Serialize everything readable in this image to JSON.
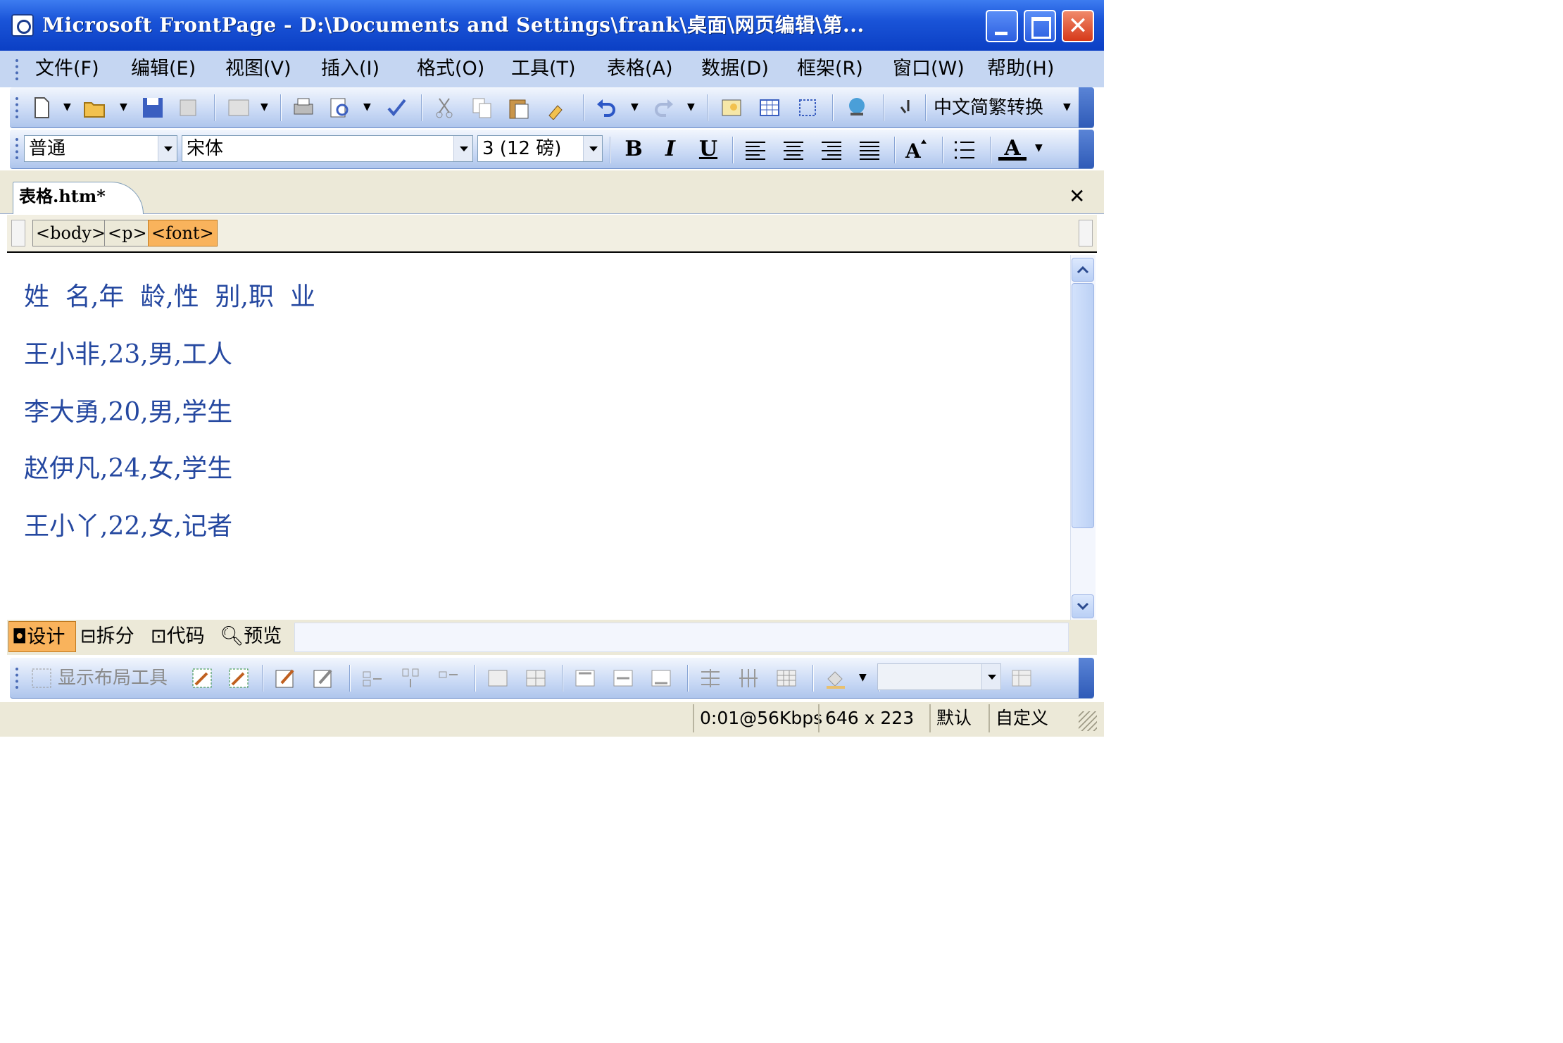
{
  "window": {
    "title": "Microsoft FrontPage - D:\\Documents and Settings\\frank\\桌面\\网页编辑\\第...",
    "close_symbol": "✕"
  },
  "menu": {
    "items": [
      {
        "label": "文件(F)"
      },
      {
        "label": "编辑(E)"
      },
      {
        "label": "视图(V)"
      },
      {
        "label": "插入(I)"
      },
      {
        "label": "格式(O)"
      },
      {
        "label": "工具(T)"
      },
      {
        "label": "表格(A)"
      },
      {
        "label": "数据(D)"
      },
      {
        "label": "框架(R)"
      },
      {
        "label": "窗口(W)"
      },
      {
        "label": "帮助(H)"
      }
    ]
  },
  "toolbar_standard": {
    "icons": [
      "new-page-icon",
      "open-icon",
      "save-icon",
      "publish-icon",
      "web-component-icon",
      "print-icon",
      "print-preview-icon",
      "spelling-icon",
      "cut-icon",
      "copy-icon",
      "paste-icon",
      "format-painter-icon",
      "undo-icon",
      "redo-icon",
      "insert-picture-icon",
      "insert-table-icon",
      "insert-layer-icon",
      "hyperlink-icon",
      "show-all-icon"
    ],
    "chinese_conversion_label": "中文简繁转换"
  },
  "toolbar_formatting": {
    "style_value": "普通",
    "font_value": "宋体",
    "size_value": "3 (12 磅)",
    "bold": "B",
    "italic": "I",
    "underline": "U",
    "font_color_glyph": "A",
    "font_color": "#000000"
  },
  "document": {
    "tab_label": "表格.htm*",
    "close_symbol": "✕",
    "tags": [
      "<body>",
      "<p>",
      "<font>"
    ],
    "selected_tag": "<font>",
    "text_color": "#2548a0",
    "lines": [
      "姓  名,年  龄,性  别,职  业",
      "王小非,23,男,工人",
      "李大勇,20,男,学生",
      "赵伊凡,24,女,学生",
      "王小丫,22,女,记者"
    ]
  },
  "view_tabs": [
    {
      "label": "设计",
      "active": true
    },
    {
      "label": "拆分",
      "active": false
    },
    {
      "label": "代码",
      "active": false
    },
    {
      "label": "预览",
      "active": false
    }
  ],
  "toolbar_layout": {
    "show_layout_tools_label": "显示布局工具"
  },
  "status": {
    "download_time": "0:01@56Kbps",
    "page_size": "646 x 223",
    "default_label": "默认",
    "custom_label": "自定义"
  }
}
